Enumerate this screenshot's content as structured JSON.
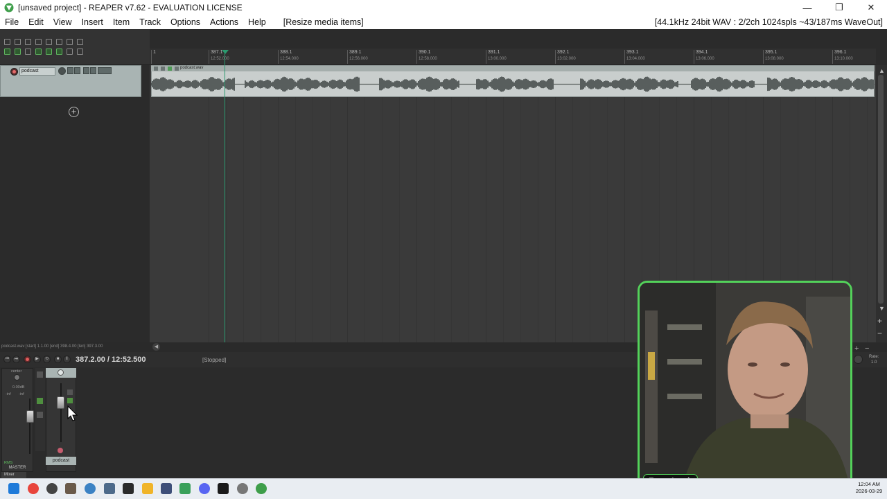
{
  "window": {
    "title": "[unsaved project] - REAPER v7.62 - EVALUATION LICENSE",
    "minimize": "—",
    "maximize": "❐",
    "close": "✕"
  },
  "menu": {
    "items": [
      "File",
      "Edit",
      "View",
      "Insert",
      "Item",
      "Track",
      "Options",
      "Actions",
      "Help"
    ],
    "status": "[Resize media items]",
    "right_info": "[44.1kHz 24bit WAV : 2/2ch 1024spls ~43/187ms WaveOut]"
  },
  "track": {
    "name": "podcast",
    "add_glyph": "+"
  },
  "ruler": {
    "marks": [
      {
        "bar": "1",
        "time": ""
      },
      {
        "bar": "387.1",
        "time": "12:52.000"
      },
      {
        "bar": "388.1",
        "time": "12:54.000"
      },
      {
        "bar": "389.1",
        "time": "12:56.000"
      },
      {
        "bar": "390.1",
        "time": "12:58.000"
      },
      {
        "bar": "391.1",
        "time": "13:00.000"
      },
      {
        "bar": "392.1",
        "time": "13:02.000"
      },
      {
        "bar": "393.1",
        "time": "13:04.000"
      },
      {
        "bar": "394.1",
        "time": "13:06.000"
      },
      {
        "bar": "395.1",
        "time": "13:08.000"
      },
      {
        "bar": "396.1",
        "time": "13:10.000"
      }
    ]
  },
  "media_item": {
    "name": "podcast.wav"
  },
  "status_strip": {
    "text": "podcast.wav [start] 1.1.00 [end] 398.4.00 [len] 397.3.00"
  },
  "transport": {
    "time": "387.2.00 / 12:52.500",
    "state": "[Stopped]",
    "rate_label": "Rate:",
    "rate_value": "1.0"
  },
  "mixer": {
    "master_label": "MASTER",
    "center_label": "center",
    "volume_label": "0.00dB",
    "inf_left": "-inf",
    "inf_right": "-inf",
    "rms_label": "RMS",
    "track_label": "podcast",
    "tab_label": "Mixer"
  },
  "webcam": {
    "face_lock_label": "Face Lock"
  },
  "taskbar": {
    "time": "12:04 AM",
    "date": "2026-03-29"
  },
  "colors": {
    "accent_green": "#53d25a",
    "edit_cursor": "#2b9a6f",
    "track_color": "#a9b4b3"
  }
}
